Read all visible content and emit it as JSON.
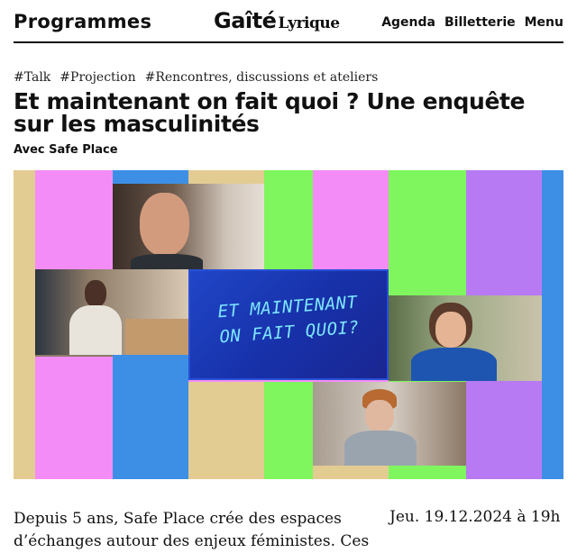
{
  "header": {
    "programmes": "Programmes",
    "logo_main": "Gaîté",
    "logo_sub": "Lyrique",
    "nav": [
      "Agenda",
      "Billetterie",
      "Menu"
    ]
  },
  "event": {
    "tags": [
      "#Talk",
      "#Projection",
      "#Rencontres, discussions et ateliers"
    ],
    "title": "Et maintenant on fait quoi ? Une enquête sur les masculinités",
    "subtitle": "Avec Safe Place",
    "poster_line1": "ET MAINTENANT",
    "poster_line2": "ON FAIT QUOI?",
    "description": "Depuis 5 ans, Safe Place crée des espaces d’échanges autour des enjeux féministes. Ces",
    "date": "Jeu. 19.12.2024 à 19h"
  },
  "colors": {
    "pink": "#f38cf7",
    "green": "#7ff55e",
    "blue": "#3d8fe6",
    "beige": "#e3cc92",
    "violet": "#b77af2",
    "card": "#1f3ab8",
    "card_text": "#7de6ff"
  }
}
